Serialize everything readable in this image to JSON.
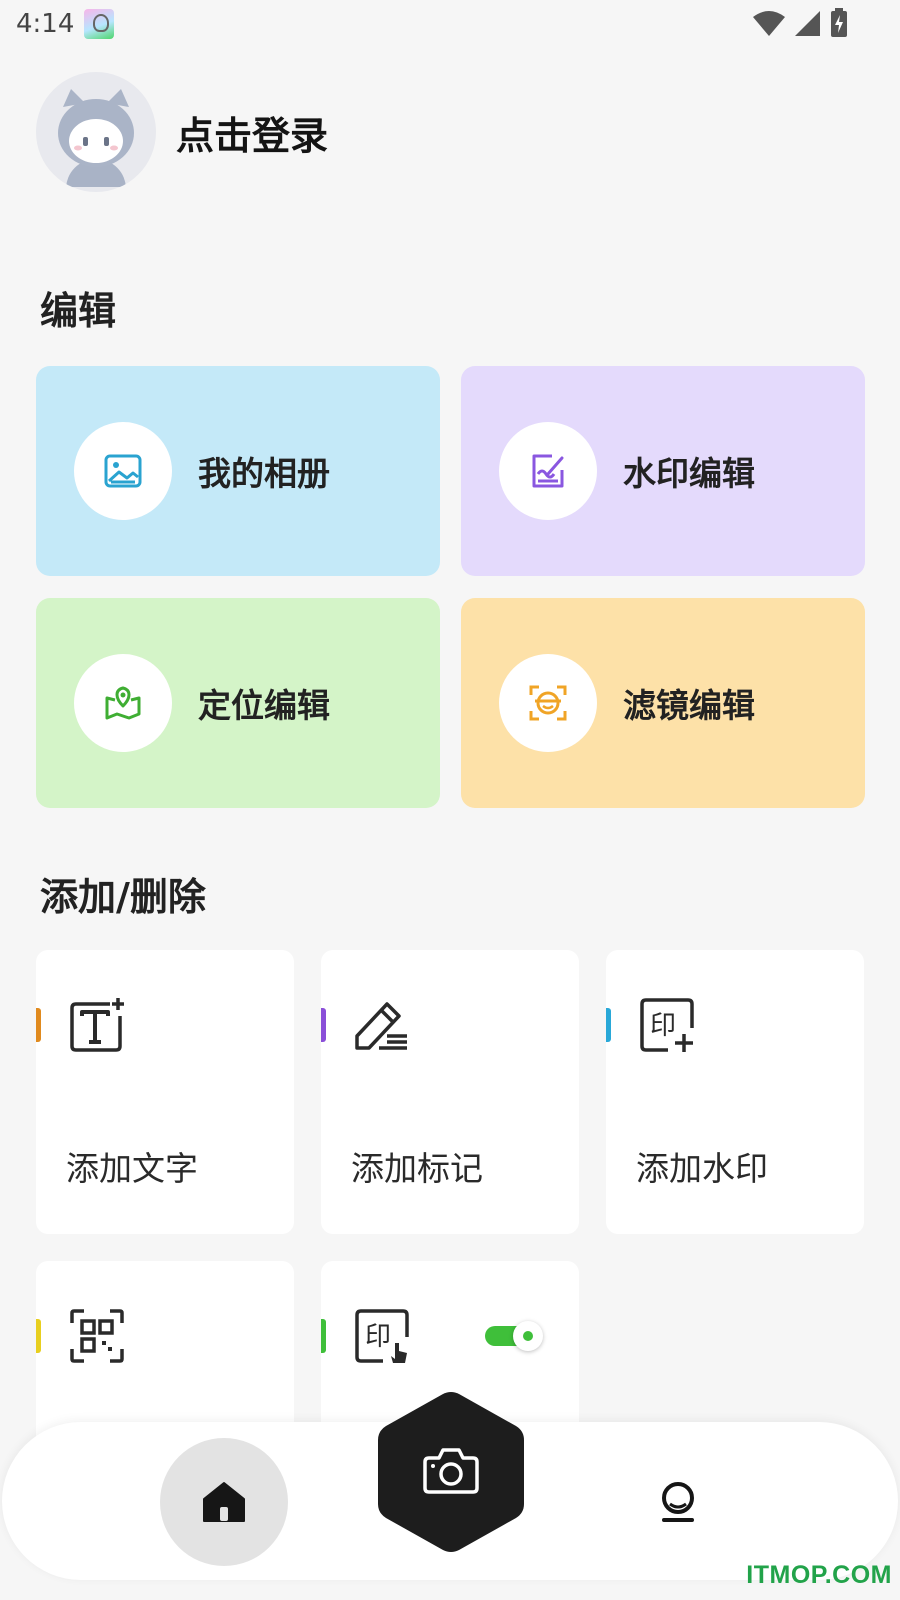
{
  "status_bar": {
    "time": "4:14",
    "icons": [
      "app-notification-icon",
      "wifi-icon",
      "cellular-signal-icon",
      "battery-charging-icon"
    ]
  },
  "profile": {
    "login_label": "点击登录"
  },
  "edit_section": {
    "title": "编辑",
    "cards": [
      {
        "label": "我的相册",
        "icon": "photo-album-icon",
        "bg": "#c4e9f8",
        "icon_color": "#2aa3d0"
      },
      {
        "label": "水印编辑",
        "icon": "edit-watermark-icon",
        "bg": "#e4dafc",
        "icon_color": "#8a57e0"
      },
      {
        "label": "定位编辑",
        "icon": "location-map-icon",
        "bg": "#d4f4c8",
        "icon_color": "#3fae33"
      },
      {
        "label": "滤镜编辑",
        "icon": "face-filter-icon",
        "bg": "#fde1a8",
        "icon_color": "#f0a426"
      }
    ]
  },
  "add_section": {
    "title": "添加/删除",
    "cards": [
      {
        "label": "添加文字",
        "icon": "add-text-icon",
        "accent": "#e08a1e"
      },
      {
        "label": "添加标记",
        "icon": "add-marker-icon",
        "accent": "#8a4fd8"
      },
      {
        "label": "添加水印",
        "icon": "add-watermark-icon",
        "accent": "#29a8d8"
      },
      {
        "label": "",
        "icon": "qr-scan-icon",
        "accent": "#e8cf1f"
      },
      {
        "label": "",
        "icon": "watermark-touch-icon",
        "accent": "#3fbf3a",
        "toggle_on": true
      }
    ]
  },
  "bottom_nav": {
    "items": [
      "home-icon",
      "camera-icon",
      "profile-icon"
    ],
    "active": "home-icon"
  },
  "watermark_text": "ITMOP.COM"
}
